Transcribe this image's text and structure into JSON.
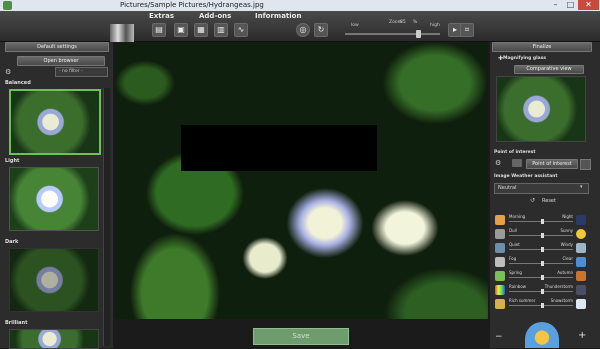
{
  "titlebar": {
    "title": "Pictures/Sample Pictures/Hydrangeas.jpg",
    "minimize": "–",
    "maximize": "□",
    "close": "✕"
  },
  "menu": {
    "extras": "Extras",
    "addons": "Add-ons",
    "information": "Information"
  },
  "toolbar": {
    "zoom_low_label": "low",
    "zoom_label": "Zoom",
    "zoom_value": "85",
    "zoom_unit": "%",
    "zoom_high_label": "high"
  },
  "left_panel": {
    "header": "Default settings",
    "open_browser": "Open browser",
    "filter_select": "- no filter -",
    "presets": [
      {
        "label": "Balanced"
      },
      {
        "label": "Light"
      },
      {
        "label": "Dark"
      },
      {
        "label": "Brilliant"
      }
    ]
  },
  "right_panel": {
    "header": "Finalize",
    "magnifying_glass": "Magnifying glass",
    "comparative_view": "Comparative view",
    "point_of_interest": "Point of interest",
    "poi_button": "Point of interest",
    "weather_title": "Image Weather assistant",
    "weather_select": "Neutral",
    "reset": "Reset",
    "weather_rows": [
      {
        "left": "Morning",
        "right": "Night"
      },
      {
        "left": "Dull",
        "right": "Sunny"
      },
      {
        "left": "Quiet",
        "right": "Windy"
      },
      {
        "left": "Fog",
        "right": "Clear"
      },
      {
        "left": "Spring",
        "right": "Autumn"
      },
      {
        "left": "Rainbow",
        "right": "Thunderstorm"
      },
      {
        "left": "Rich summer",
        "right": "Snowstorm"
      }
    ]
  },
  "save_label": "Save",
  "colors": {
    "accent": "#6fbf5a",
    "save_bg": "#6e9c6e"
  }
}
